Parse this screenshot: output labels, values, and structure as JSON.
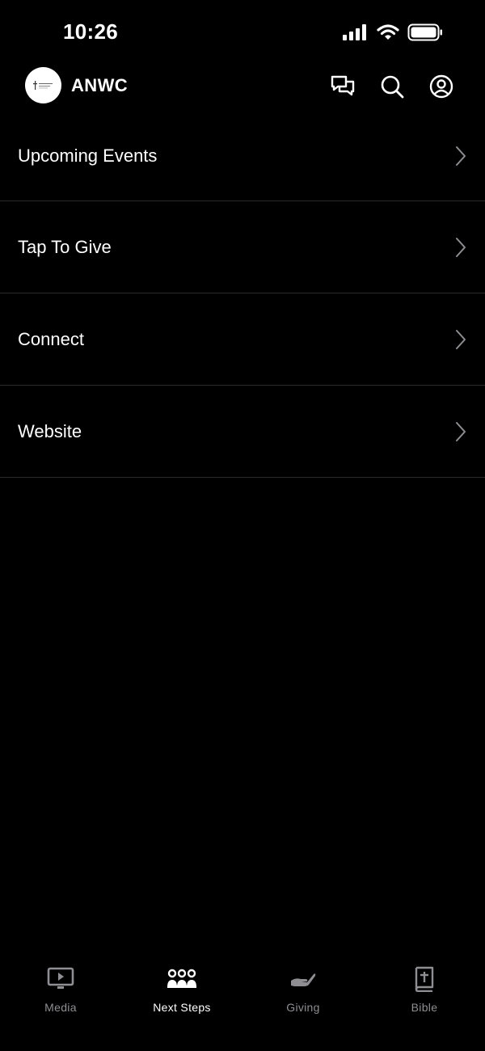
{
  "status_bar": {
    "time": "10:26"
  },
  "header": {
    "title": "ANWC"
  },
  "menu": {
    "items": [
      {
        "label": "Upcoming Events"
      },
      {
        "label": "Tap To Give"
      },
      {
        "label": "Connect"
      },
      {
        "label": "Website"
      }
    ]
  },
  "tabs": {
    "active": "Next Steps",
    "items": [
      {
        "label": "Media",
        "icon": "tv-play-icon"
      },
      {
        "label": "Next Steps",
        "icon": "people-group-icon"
      },
      {
        "label": "Giving",
        "icon": "hand-giving-icon"
      },
      {
        "label": "Bible",
        "icon": "bible-icon"
      }
    ]
  },
  "colors": {
    "background": "#000000",
    "text": "#ffffff",
    "inactive_tab": "#8e8e93",
    "divider": "#2a2a2a"
  }
}
